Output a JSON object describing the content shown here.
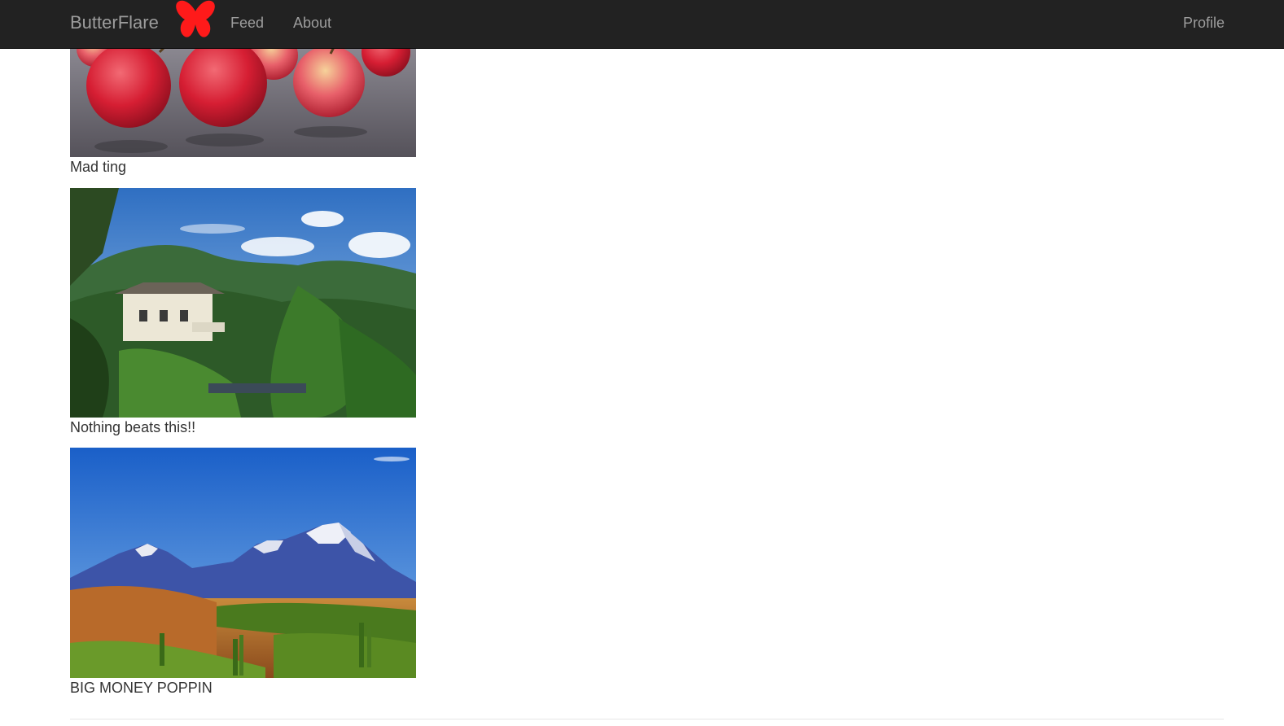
{
  "nav": {
    "brand": "ButterFlare",
    "logo_icon": "butterfly-icon",
    "logo_color": "#ff1a1a",
    "links": [
      "Feed",
      "About"
    ],
    "profile": "Profile",
    "background": "#222222",
    "link_color": "#9d9d9d"
  },
  "posts": [
    {
      "image": "apples-photo",
      "caption": "Mad ting"
    },
    {
      "image": "tropical-house-mountains-photo",
      "caption": "Nothing beats this!!"
    },
    {
      "image": "snowy-mountains-landscape-photo",
      "caption": "BIG MONEY POPPIN"
    }
  ]
}
